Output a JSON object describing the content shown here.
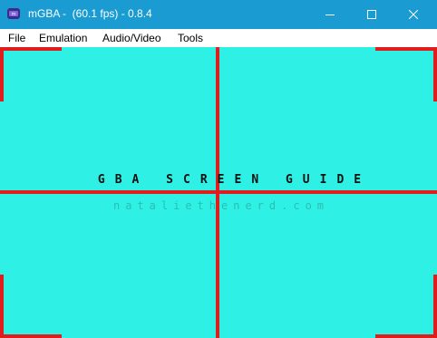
{
  "window": {
    "title": "mGBA -  (60.1 fps) - 0.8.4",
    "controls": {
      "minimize_icon": "minimize-icon",
      "maximize_icon": "maximize-icon",
      "close_icon": "close-icon"
    }
  },
  "menu": {
    "file": "File",
    "emulation": "Emulation",
    "audio_video": "Audio/Video",
    "tools": "Tools"
  },
  "screen": {
    "title": "GBA SCREEN GUIDE",
    "credit": "nataliethenerd.com",
    "background_color": "#2ff0e4",
    "guide_color": "#e01c1c"
  },
  "colors": {
    "titlebar": "#1a9bd1"
  }
}
